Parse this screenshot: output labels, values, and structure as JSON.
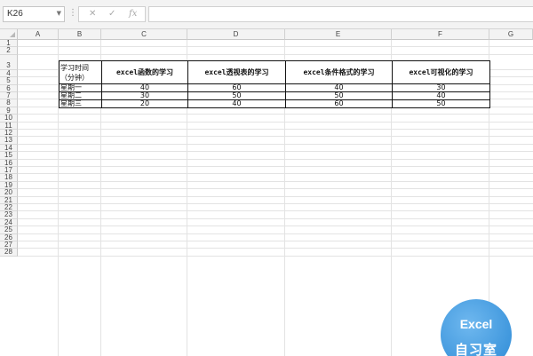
{
  "name_box": {
    "value": "K26"
  },
  "formula_bar": {
    "cancel_icon": "✕",
    "confirm_icon": "✓",
    "fx_label": "fx",
    "value": ""
  },
  "sheet": {
    "columns": [
      "A",
      "B",
      "C",
      "D",
      "E",
      "F",
      "G"
    ],
    "rows": [
      "1",
      "2",
      "3",
      "4",
      "5",
      "6",
      "7",
      "8",
      "9",
      "10",
      "11",
      "12",
      "13",
      "14",
      "15",
      "16",
      "17",
      "18",
      "19",
      "20",
      "21",
      "22",
      "23",
      "24",
      "25",
      "26",
      "27",
      "28"
    ],
    "table": {
      "header_b_line1": "学习时间",
      "header_b_line2": "（分钟）",
      "headers": [
        "excel函数的学习",
        "excel透视表的学习",
        "excel条件格式的学习",
        "excel可视化的学习"
      ],
      "rows": [
        {
          "day": "星期一",
          "values": [
            "40",
            "60",
            "40",
            "30"
          ]
        },
        {
          "day": "星期二",
          "values": [
            "30",
            "50",
            "50",
            "40"
          ]
        },
        {
          "day": "星期三",
          "values": [
            "20",
            "40",
            "60",
            "50"
          ]
        }
      ]
    }
  },
  "watermark": {
    "line1": "Excel",
    "line2": "自习室"
  }
}
